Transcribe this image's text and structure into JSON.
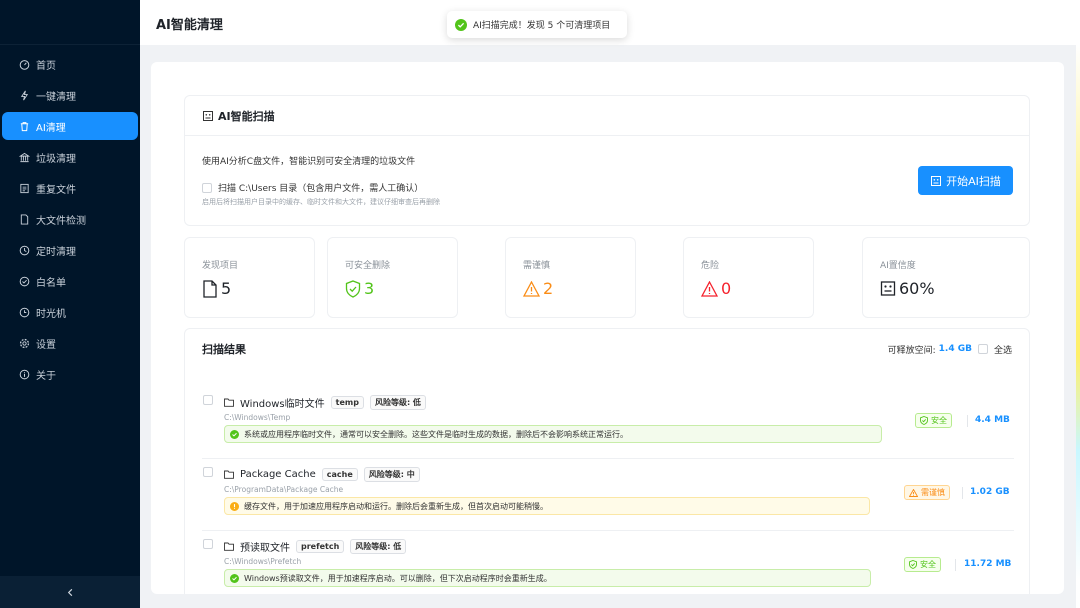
{
  "header": {
    "title": "AI智能清理"
  },
  "toast": {
    "text": "AI扫描完成！发现 5 个可清理项目",
    "icon": "check-circle-icon"
  },
  "sidebar": {
    "items": [
      {
        "label": "首页",
        "icon": "dashboard-icon"
      },
      {
        "label": "一键清理",
        "icon": "lightning-icon"
      },
      {
        "label": "AI清理",
        "icon": "trash-icon",
        "active": true
      },
      {
        "label": "垃圾清理",
        "icon": "bank-icon"
      },
      {
        "label": "重复文件",
        "icon": "copy-icon"
      },
      {
        "label": "大文件检测",
        "icon": "file-icon"
      },
      {
        "label": "定时清理",
        "icon": "clock-icon"
      },
      {
        "label": "白名单",
        "icon": "shield-check-icon"
      },
      {
        "label": "时光机",
        "icon": "history-icon"
      },
      {
        "label": "设置",
        "icon": "gear-icon"
      },
      {
        "label": "关于",
        "icon": "info-icon"
      }
    ]
  },
  "scan": {
    "title": "AI智能扫描",
    "description": "使用AI分析C盘文件，智能识别可安全清理的垃圾文件",
    "checkbox_label": "扫描 C:\\Users 目录（包含用户文件，需人工确认）",
    "checkbox_hint": "启用后将扫描用户目录中的缓存、临时文件和大文件，建议仔细审查后再删除",
    "button_label": "开始AI扫描"
  },
  "stats": [
    {
      "label": "发现项目",
      "value": "5",
      "icon": "file-icon",
      "color": "#1f2329"
    },
    {
      "label": "可安全删除",
      "value": "3",
      "icon": "safety-icon",
      "color": "#52c41a"
    },
    {
      "label": "需谨慎",
      "value": "2",
      "icon": "warning-icon",
      "color": "#fa8c16"
    },
    {
      "label": "危险",
      "value": "0",
      "icon": "warning-icon",
      "color": "#f5222d"
    },
    {
      "label": "AI置信度",
      "value": "60%",
      "icon": "robot-icon",
      "color": "#1f2329"
    }
  ],
  "results": {
    "title": "扫描结果",
    "free_label": "可释放空间:",
    "free_value": "1.4 GB",
    "select_all": "全选",
    "items": [
      {
        "name": "Windows临时文件",
        "tag": "temp",
        "risk": "风险等级: 低",
        "path": "C:\\Windows\\Temp",
        "desc": "系统或应用程序临时文件，通常可以安全删除。这些文件是临时生成的数据，删除后不会影响系统正常运行。",
        "status": "安全",
        "status_type": "safe",
        "size": "4.4 MB"
      },
      {
        "name": "Package Cache",
        "tag": "cache",
        "risk": "风险等级: 中",
        "path": "C:\\ProgramData\\Package Cache",
        "desc": "缓存文件，用于加速应用程序启动和运行。删除后会重新生成，但首次启动可能稍慢。",
        "status": "需谨慎",
        "status_type": "warn",
        "size": "1.02 GB"
      },
      {
        "name": "预读取文件",
        "tag": "prefetch",
        "risk": "风险等级: 低",
        "path": "C:\\Windows\\Prefetch",
        "desc": "Windows预读取文件，用于加速程序启动。可以删除，但下次启动程序时会重新生成。",
        "status": "安全",
        "status_type": "safe",
        "size": "11.72 MB"
      }
    ]
  }
}
